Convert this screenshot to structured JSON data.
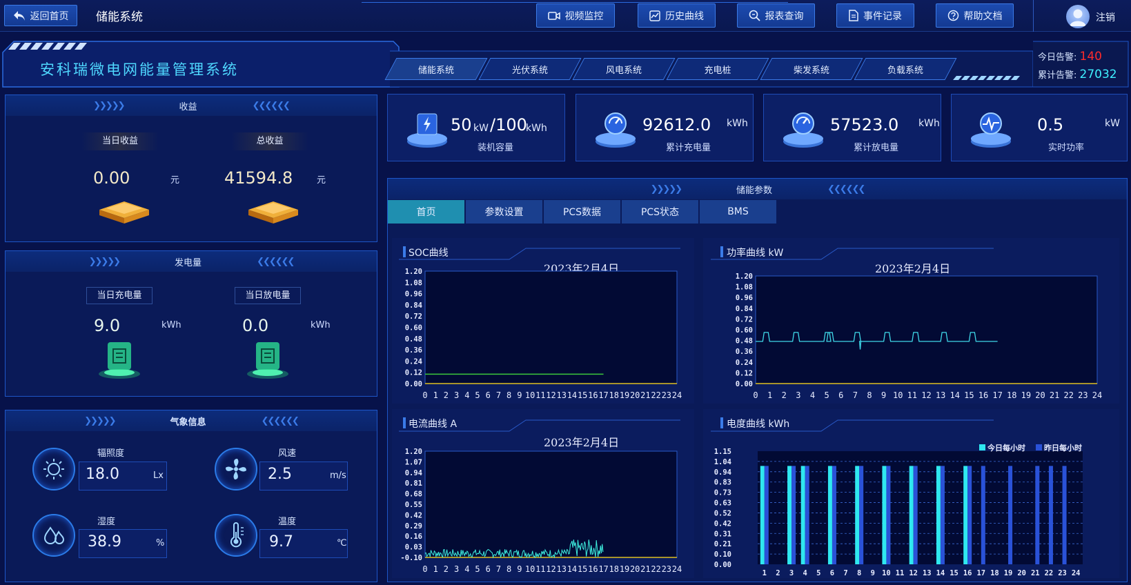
{
  "topbar": {
    "back_label": "返回首页",
    "system_name": "储能系统",
    "buttons": [
      {
        "label": "视频监控",
        "icon": "video-icon"
      },
      {
        "label": "历史曲线",
        "icon": "chart-icon"
      },
      {
        "label": "报表查询",
        "icon": "search-icon"
      },
      {
        "label": "事件记录",
        "icon": "document-icon"
      },
      {
        "label": "帮助文档",
        "icon": "help-icon"
      }
    ],
    "logout_label": "注销"
  },
  "header": {
    "title": "安科瑞微电网能量管理系统",
    "tabs": [
      "储能系统",
      "光伏系统",
      "风电系统",
      "充电桩",
      "柴发系统",
      "负载系统"
    ],
    "alarm_today_label": "今日告警:",
    "alarm_today": "140",
    "alarm_total_label": "累计告警:",
    "alarm_total": "27032",
    "alarm_today_color": "#ff2a2a",
    "alarm_total_color": "#3ff0ff"
  },
  "income": {
    "title": "收益",
    "today_label": "当日收益",
    "total_label": "总收益",
    "today_value": "0.00",
    "total_value": "41594.8",
    "unit": "元"
  },
  "energy": {
    "title": "发电量",
    "charge_label": "当日充电量",
    "discharge_label": "当日放电量",
    "charge_value": "9.0",
    "discharge_value": "0.0",
    "unit": "kWh"
  },
  "weather": {
    "title": "气象信息",
    "items": [
      {
        "label": "辐照度",
        "value": "18.0",
        "unit": "Lx",
        "icon": "sun-icon"
      },
      {
        "label": "风速",
        "value": "2.5",
        "unit": "m/s",
        "icon": "fan-icon"
      },
      {
        "label": "湿度",
        "value": "38.9",
        "unit": "%",
        "icon": "humidity-icon"
      },
      {
        "label": "温度",
        "value": "9.7",
        "unit": "℃",
        "icon": "thermometer-icon"
      }
    ]
  },
  "stats": [
    {
      "value": "50",
      "unit1": "kW",
      "sep": "/100",
      "unit2": "kWh",
      "label": "装机容量",
      "icon": "battery-icon"
    },
    {
      "value": "92612.0",
      "unit": "kWh",
      "label": "累计充电量",
      "icon": "gauge-icon"
    },
    {
      "value": "57523.0",
      "unit": "kWh",
      "label": "累计放电量",
      "icon": "gauge-icon"
    },
    {
      "value": "0.5",
      "unit": "kW",
      "label": "实时功率",
      "icon": "pulse-icon"
    }
  ],
  "params": {
    "title": "储能参数",
    "tabs": [
      "首页",
      "参数设置",
      "PCS数据",
      "PCS状态",
      "BMS"
    ],
    "active_tab": 0
  },
  "charts": {
    "soc": {
      "title": "SOC曲线",
      "date": "2023年2月4日"
    },
    "power": {
      "title": "功率曲线  kW",
      "date": "2023年2月4日"
    },
    "current": {
      "title": "电流曲线  A",
      "date": "2023年2月4日"
    },
    "energy": {
      "title": "电度曲线  kWh",
      "legend_today": "今日每小时",
      "legend_yesterday": "昨日每小时"
    }
  },
  "chart_data": [
    {
      "type": "line",
      "name": "soc",
      "x": [
        0,
        17
      ],
      "y": [
        0.1,
        0.1
      ],
      "xlim": [
        0,
        24
      ],
      "ylim": [
        0,
        1.2
      ],
      "yticks": [
        "1.20",
        "1.08",
        "0.96",
        "0.84",
        "0.72",
        "0.60",
        "0.48",
        "0.36",
        "0.24",
        "0.12",
        "0.00"
      ],
      "xticks": [
        "0",
        "1",
        "2",
        "3",
        "4",
        "5",
        "6",
        "7",
        "8",
        "9",
        "10",
        "11",
        "12",
        "13",
        "14",
        "15",
        "16",
        "17",
        "18",
        "19",
        "20",
        "21",
        "22",
        "23",
        "24"
      ],
      "color": "#3cc83c"
    },
    {
      "type": "line",
      "name": "power",
      "baseline": 0.47,
      "spikes": [
        0.5,
        2.6,
        4.8,
        5.0,
        6.9,
        9.0,
        11.0,
        13.0,
        15.0
      ],
      "spike_value": 0.57,
      "dip_x": 7.3,
      "dip_value": 0.38,
      "x_end": 17,
      "xlim": [
        0,
        24
      ],
      "ylim": [
        0,
        1.2
      ],
      "yticks": [
        "1.20",
        "1.08",
        "0.96",
        "0.84",
        "0.72",
        "0.60",
        "0.48",
        "0.36",
        "0.24",
        "0.12",
        "0.00"
      ],
      "xticks": [
        "0",
        "1",
        "2",
        "3",
        "4",
        "5",
        "6",
        "7",
        "8",
        "9",
        "10",
        "11",
        "12",
        "13",
        "14",
        "15",
        "16",
        "17",
        "18",
        "19",
        "20",
        "21",
        "22",
        "23",
        "24"
      ],
      "color": "#3fd8e8"
    },
    {
      "type": "line",
      "name": "current",
      "baseline": -0.07,
      "noise_low": -0.1,
      "noise_high": 0.0,
      "burst_x": [
        13.8,
        17
      ],
      "burst_high": 0.12,
      "xlim": [
        0,
        24
      ],
      "ylim": [
        -0.1,
        1.2
      ],
      "yticks": [
        "1.20",
        "1.07",
        "0.94",
        "0.81",
        "0.68",
        "0.55",
        "0.42",
        "0.29",
        "0.16",
        "0.03",
        "-0.10"
      ],
      "xticks": [
        "0",
        "1",
        "2",
        "3",
        "4",
        "5",
        "6",
        "7",
        "8",
        "9",
        "10",
        "11",
        "12",
        "13",
        "14",
        "15",
        "16",
        "17",
        "18",
        "19",
        "20",
        "21",
        "22",
        "23",
        "24"
      ],
      "color": "#3ff0e0"
    },
    {
      "type": "bar",
      "name": "energy",
      "categories": [
        "1",
        "2",
        "3",
        "4",
        "5",
        "6",
        "7",
        "8",
        "9",
        "10",
        "11",
        "12",
        "13",
        "14",
        "15",
        "16",
        "17",
        "18",
        "19",
        "20",
        "21",
        "22",
        "23",
        "24"
      ],
      "series": [
        {
          "name": "今日每小时",
          "values": [
            1,
            0,
            1,
            1,
            0,
            1,
            0,
            1,
            0,
            1,
            0,
            1,
            0,
            1,
            0,
            1,
            0,
            0,
            0,
            0,
            0,
            0,
            0,
            0
          ],
          "color": "#2fe8f0"
        },
        {
          "name": "昨日每小时",
          "values": [
            1,
            0,
            1,
            1,
            0,
            1,
            0,
            1,
            0,
            1,
            0,
            1,
            0,
            1,
            0,
            1,
            1,
            0,
            1,
            0,
            1,
            1,
            1,
            0
          ],
          "color": "#2a52d8"
        }
      ],
      "ylim": [
        0,
        1.15
      ],
      "yticks": [
        "1.15",
        "1.04",
        "0.94",
        "0.83",
        "0.73",
        "0.63",
        "0.52",
        "0.42",
        "0.31",
        "0.21",
        "0.10",
        "0.00"
      ]
    }
  ]
}
